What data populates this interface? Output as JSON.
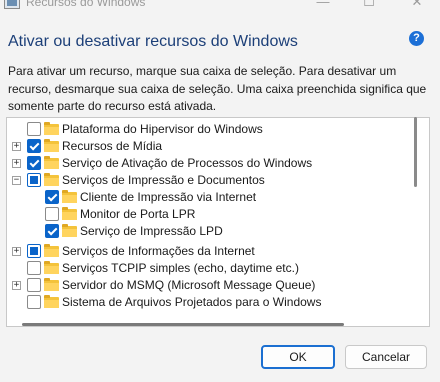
{
  "window": {
    "title": "Recursos do Windows",
    "minimize": "—",
    "maximize": "☐",
    "close": "✕"
  },
  "heading": "Ativar ou desativar recursos do Windows",
  "help_icon": "?",
  "description": "Para ativar um recurso, marque sua caixa de seleção. Para desativar um recurso, desmarque sua caixa de seleção. Uma caixa preenchida significa que somente parte do recurso está ativada.",
  "tree": {
    "items": [
      {
        "label": "Plataforma do Hipervisor do Windows",
        "state": "unchecked",
        "expander": ""
      },
      {
        "label": "Recursos de Mídia",
        "state": "checked",
        "expander": "+"
      },
      {
        "label": "Serviço de Ativação de Processos do Windows",
        "state": "checked",
        "expander": "+"
      },
      {
        "label": "Serviços de Impressão e Documentos",
        "state": "partial",
        "expander": "−"
      },
      {
        "label": "Cliente de Impressão via Internet",
        "state": "checked",
        "expander": ""
      },
      {
        "label": "Monitor de Porta LPR",
        "state": "unchecked",
        "expander": ""
      },
      {
        "label": "Serviço de Impressão LPD",
        "state": "checked",
        "expander": ""
      },
      {
        "label": "Serviços de Informações da Internet",
        "state": "partial",
        "expander": "+"
      },
      {
        "label": "Serviços TCPIP simples (echo, daytime etc.)",
        "state": "unchecked",
        "expander": ""
      },
      {
        "label": "Servidor do MSMQ (Microsoft Message Queue)",
        "state": "unchecked",
        "expander": "+"
      },
      {
        "label": "Sistema de Arquivos Projetados para o Windows",
        "state": "unchecked",
        "expander": ""
      }
    ]
  },
  "buttons": {
    "ok": "OK",
    "cancel": "Cancelar"
  },
  "colors": {
    "accent": "#0a64c9",
    "heading": "#1c3f78",
    "folder": "#f4c33b"
  }
}
